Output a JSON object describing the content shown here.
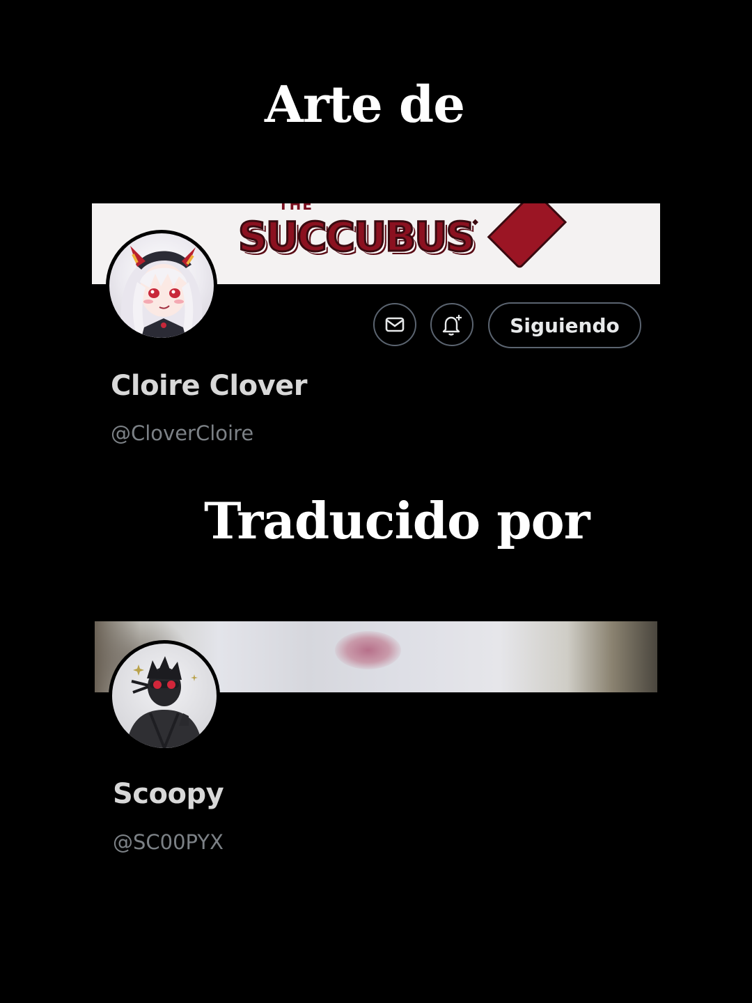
{
  "headings": {
    "art_by": "Arte de",
    "translated_by": "Traducido por"
  },
  "artist": {
    "banner_text": "SUCCUBUS",
    "banner_top_text": "THE",
    "display_name": "Cloire Clover",
    "handle": "@CloverCloire",
    "avatar": "anime-girl-avatar",
    "actions": {
      "message_icon": "envelope-icon",
      "notify_icon": "bell-plus-icon",
      "follow_label": "Siguiendo"
    }
  },
  "translator": {
    "display_name": "Scoopy",
    "handle": "@SC00PYX",
    "avatar": "ninja-avatar",
    "banner": "blurred-cat-photo"
  },
  "colors": {
    "background": "#000000",
    "heading_text": "#ffffff",
    "name_text": "#d8d8d8",
    "handle_text": "#7c8186",
    "button_border": "#5b6470",
    "brand_red": "#8b1120"
  }
}
